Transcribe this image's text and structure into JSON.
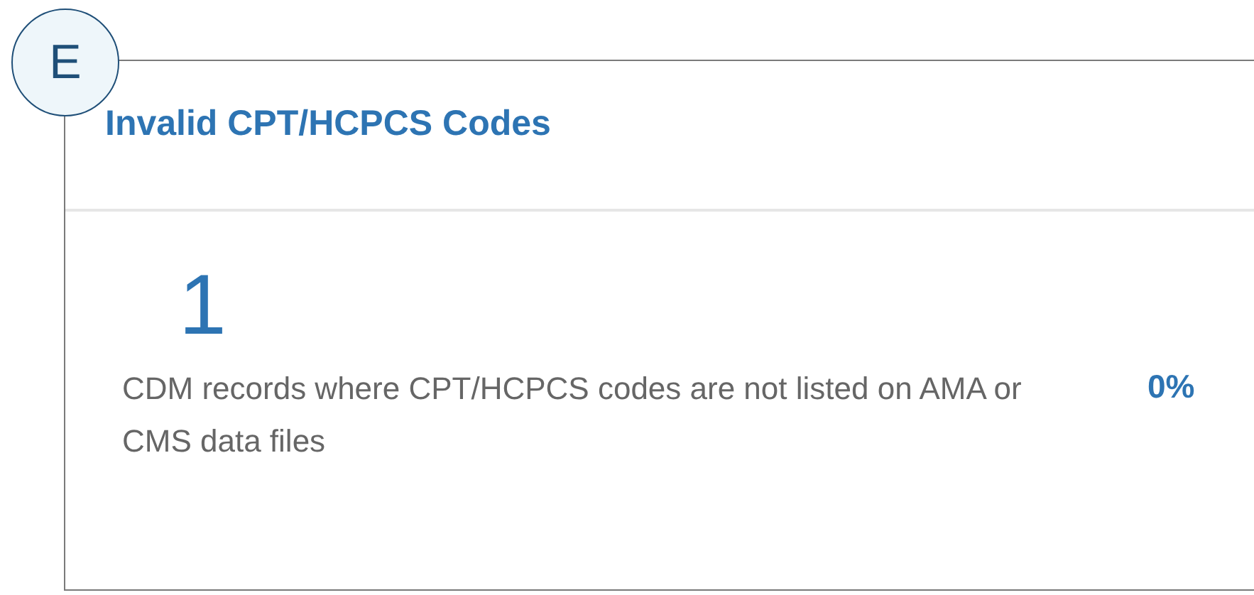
{
  "badge": "E",
  "card": {
    "title": "Invalid CPT/HCPCS Codes",
    "count": "1",
    "description": "CDM records where CPT/HCPCS codes are not listed on AMA or CMS data files",
    "percent": "0%"
  }
}
